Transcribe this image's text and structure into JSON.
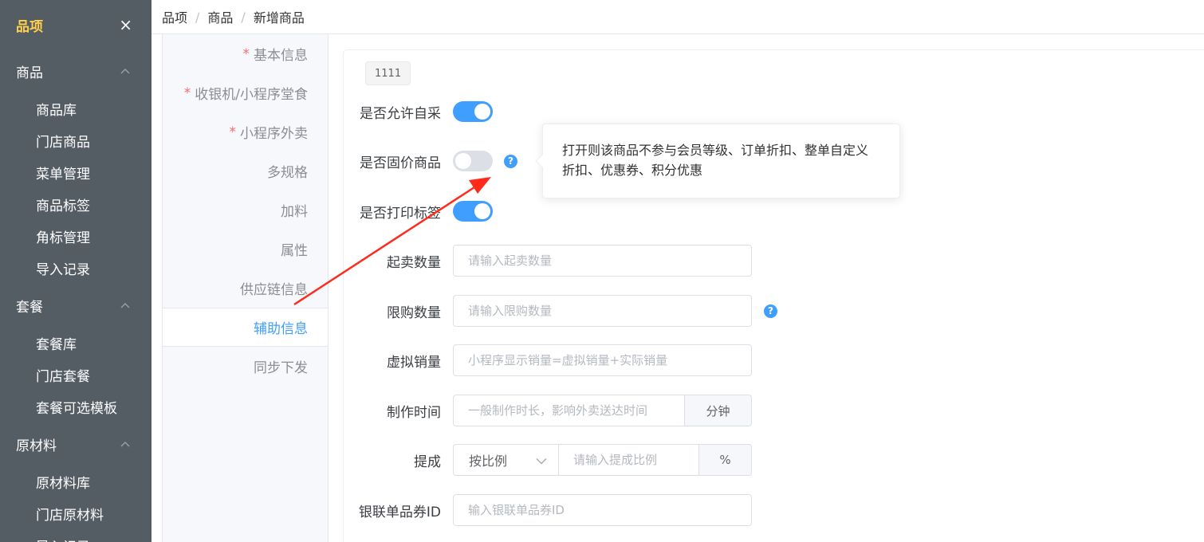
{
  "sidebar": {
    "title": "品项",
    "close_glyph": "×",
    "groups": [
      {
        "label": "商品",
        "items": [
          "商品库",
          "门店商品",
          "菜单管理",
          "商品标签",
          "角标管理",
          "导入记录"
        ]
      },
      {
        "label": "套餐",
        "items": [
          "套餐库",
          "门店套餐",
          "套餐可选模板"
        ]
      },
      {
        "label": "原材料",
        "items": [
          "原材料库",
          "门店原材料",
          "导入记录"
        ]
      }
    ],
    "title_color": "#ffd04b",
    "bg_color": "#545c64"
  },
  "breadcrumb": [
    "品项",
    "商品",
    "新增商品"
  ],
  "breadcrumb_separator": "/",
  "tabs": [
    {
      "label": "基本信息",
      "required": true
    },
    {
      "label": "收银机/小程序堂食",
      "required": true
    },
    {
      "label": "小程序外卖",
      "required": true
    },
    {
      "label": "多规格",
      "required": false
    },
    {
      "label": "加料",
      "required": false
    },
    {
      "label": "属性",
      "required": false
    },
    {
      "label": "供应链信息",
      "required": false
    },
    {
      "label": "辅助信息",
      "required": false,
      "active": true
    },
    {
      "label": "同步下发",
      "required": false
    }
  ],
  "required_mark": "*",
  "form": {
    "tag": "1111",
    "allow_self_purchase": {
      "label": "是否允许自采",
      "enabled": true
    },
    "fixed_price": {
      "label": "是否固价商品",
      "enabled": false
    },
    "print_label": {
      "label": "是否打印标签",
      "enabled": true
    },
    "min_sale_qty": {
      "label": "起卖数量",
      "placeholder": "请输入起卖数量"
    },
    "purchase_limit": {
      "label": "限购数量",
      "placeholder": "请输入限购数量"
    },
    "virtual_sales": {
      "label": "虚拟销量",
      "placeholder": "小程序显示销量=虚拟销量+实际销量"
    },
    "prep_time": {
      "label": "制作时间",
      "placeholder": "一般制作时长，影响外卖送达时间",
      "unit": "分钟"
    },
    "commission": {
      "label": "提成",
      "mode": "按比例",
      "placeholder": "请输入提成比例",
      "unit": "%"
    },
    "unionpay_coupon": {
      "label": "银联单品券ID",
      "placeholder": "输入银联单品券ID"
    }
  },
  "help_glyph": "?",
  "tooltip": {
    "text": "打开则该商品不参与会员等级、订单折扣、整单自定义折扣、优惠券、积分优惠"
  },
  "colors": {
    "primary": "#409eff",
    "required": "#f56c6c",
    "annotation_arrow": "#ff2a1a"
  }
}
